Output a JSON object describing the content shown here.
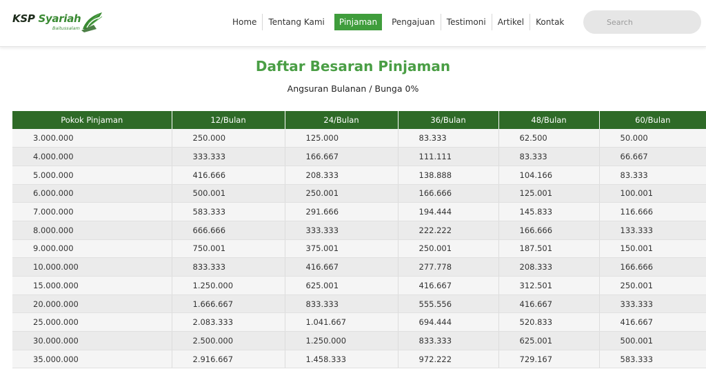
{
  "brand": {
    "name_part1": "KSP ",
    "name_part2": "Syariah",
    "subtitle": "Baitussalam",
    "logo_icon": "leaf-book-icon",
    "colors": {
      "green": "#3a8a33",
      "dark": "#1c2a1a"
    }
  },
  "nav": {
    "items": [
      {
        "label": "Home"
      },
      {
        "label": "Tentang Kami"
      },
      {
        "label": "Pinjaman",
        "active": true
      },
      {
        "label": "Pengajuan"
      },
      {
        "label": "Testimoni"
      },
      {
        "label": "Artikel"
      },
      {
        "label": "Kontak"
      }
    ],
    "active_color": "#3f9d3c"
  },
  "search": {
    "placeholder": "Search",
    "value": ""
  },
  "page": {
    "title": "Daftar Besaran Pinjaman",
    "subtitle": "Angsuran Bulanan / Bunga 0%"
  },
  "table": {
    "header_color": "#2e6a27",
    "columns": [
      "Pokok Pinjaman",
      "12/Bulan",
      "24/Bulan",
      "36/Bulan",
      "48/Bulan",
      "60/Bulan"
    ],
    "rows": [
      [
        "3.000.000",
        "250.000",
        "125.000",
        "83.333",
        "62.500",
        "50.000"
      ],
      [
        "4.000.000",
        "333.333",
        "166.667",
        "111.111",
        "83.333",
        "66.667"
      ],
      [
        "5.000.000",
        "416.666",
        "208.333",
        "138.888",
        "104.166",
        "83.333"
      ],
      [
        "6.000.000",
        "500.001",
        "250.001",
        "166.666",
        "125.001",
        "100.001"
      ],
      [
        "7.000.000",
        "583.333",
        "291.666",
        "194.444",
        "145.833",
        "116.666"
      ],
      [
        "8.000.000",
        "666.666",
        "333.333",
        "222.222",
        "166.666",
        "133.333"
      ],
      [
        "9.000.000",
        "750.001",
        "375.001",
        "250.001",
        "187.501",
        "150.001"
      ],
      [
        "10.000.000",
        "833.333",
        "416.667",
        "277.778",
        "208.333",
        "166.666"
      ],
      [
        "15.000.000",
        "1.250.000",
        "625.001",
        "416.667",
        "312.501",
        "250.001"
      ],
      [
        "20.000.000",
        "1.666.667",
        "833.333",
        "555.556",
        "416.667",
        "333.333"
      ],
      [
        "25.000.000",
        "2.083.333",
        "1.041.667",
        "694.444",
        "520.833",
        "416.667"
      ],
      [
        "30.000.000",
        "2.500.000",
        "1.250.000",
        "833.333",
        "625.001",
        "500.001"
      ],
      [
        "35.000.000",
        "2.916.667",
        "1.458.333",
        "972.222",
        "729.167",
        "583.333"
      ]
    ]
  }
}
